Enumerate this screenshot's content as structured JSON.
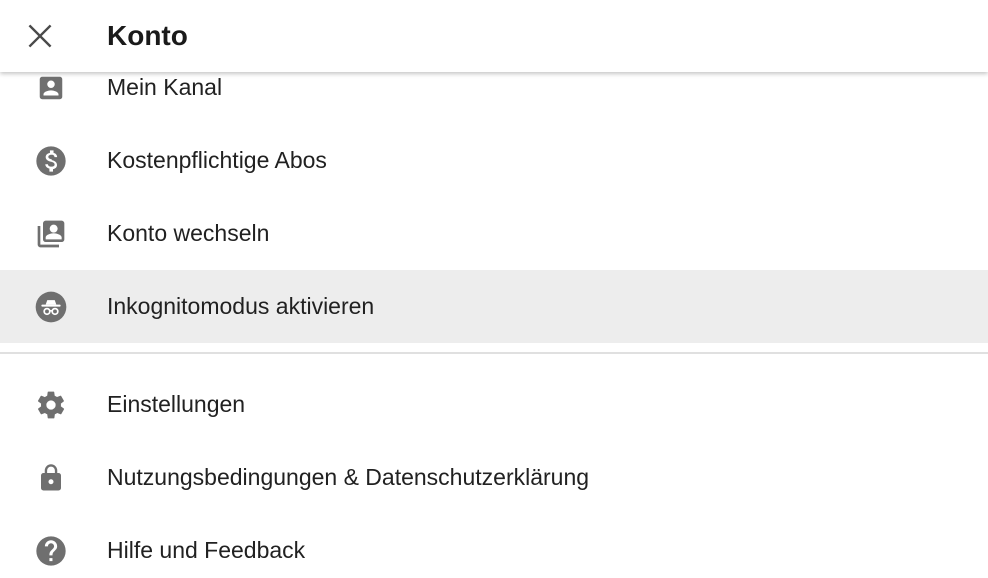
{
  "header": {
    "title": "Konto",
    "close_icon": "close-icon"
  },
  "menu": {
    "group1": [
      {
        "label": "Mein Kanal",
        "icon": "account-box-icon"
      },
      {
        "label": "Kostenpflichtige Abos",
        "icon": "dollar-circle-icon"
      },
      {
        "label": "Konto wechseln",
        "icon": "switch-account-icon"
      },
      {
        "label": "Inkognitomodus aktivieren",
        "icon": "incognito-icon",
        "highlighted": true
      }
    ],
    "group2": [
      {
        "label": "Einstellungen",
        "icon": "gear-icon"
      },
      {
        "label": "Nutzungsbedingungen & Datenschutzerklärung",
        "icon": "lock-icon"
      },
      {
        "label": "Hilfe und Feedback",
        "icon": "help-circle-icon"
      }
    ]
  },
  "colors": {
    "icon": "#6f6f6f",
    "text": "#212121",
    "highlight": "#ededed",
    "divider": "#e0e0e0"
  }
}
